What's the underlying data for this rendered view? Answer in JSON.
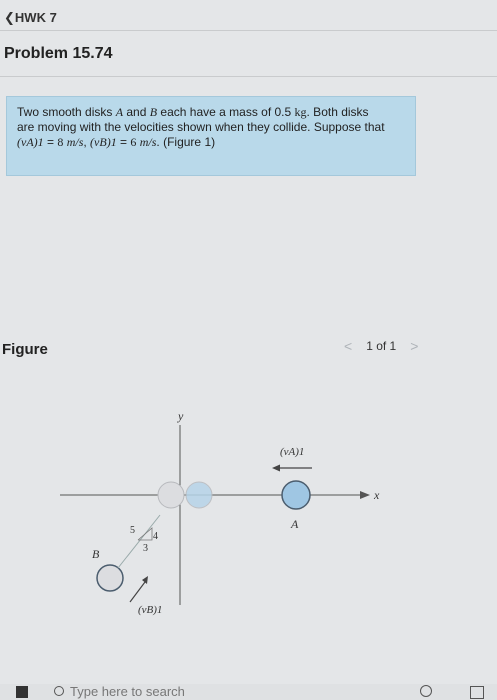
{
  "nav": {
    "back_label": "HWK 7"
  },
  "problem": {
    "title": "Problem 15.74",
    "text": {
      "line1_a": "Two smooth disks ",
      "line1_A": "A",
      "line1_b": " and ",
      "line1_B": "B",
      "line1_c": " each have a mass of 0.5 ",
      "line1_unit": "kg",
      "line1_d": ". Both disks",
      "line2": "are moving with the velocities shown when they collide. Suppose that",
      "va_symbol": "(vA)1",
      "va_value": "8",
      "vb_symbol": "(vB)1",
      "vb_value": "6",
      "unit": "m/s",
      "figure_ref": "(Figure 1)"
    }
  },
  "figure": {
    "label": "Figure",
    "pager": {
      "text": "1 of 1",
      "prev_symbol": "<",
      "next_symbol": ">"
    },
    "diagram": {
      "y_axis_label": "y",
      "x_axis_label": "x",
      "disk_a_label": "A",
      "disk_b_label": "B",
      "va_label": "(vA)1",
      "vb_label": "(vB)1",
      "slope_hyp": "5",
      "slope_x": "4",
      "slope_y": "3"
    }
  },
  "taskbar": {
    "search_placeholder": "Type here to search"
  },
  "colors": {
    "accent_box": "#b9d9ea",
    "disk_fill": "#9fc6e3",
    "disk_stroke": "#4b5d6e"
  }
}
